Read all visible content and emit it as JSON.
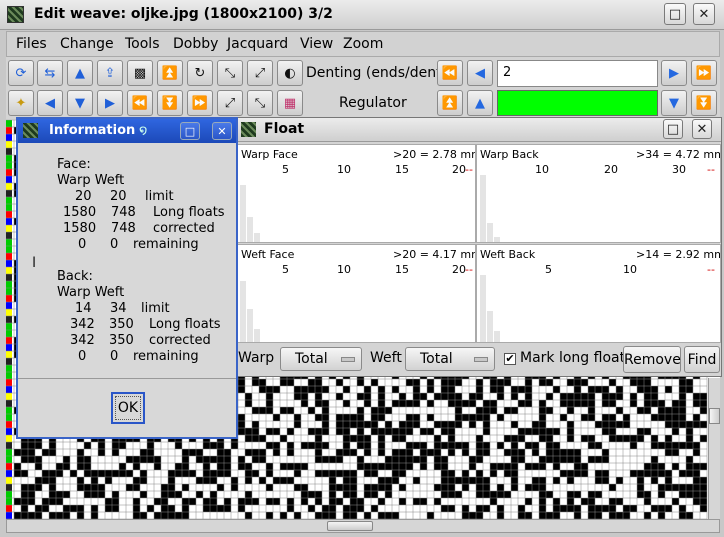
{
  "main_window": {
    "title": "Edit weave: oljke.jpg (1800x2100) 3/2",
    "buttons": {
      "maximize": "□",
      "close": "✕"
    }
  },
  "menubar": {
    "items": [
      "Files",
      "Change",
      "Tools",
      "Dobby",
      "Jacquard",
      "View",
      "Zoom"
    ]
  },
  "toolbar": {
    "denting_label": "Denting (ends/dent)",
    "denting_value": "2",
    "regulator_label": "Regulator",
    "regulator_color": "#00ff00"
  },
  "float_window": {
    "title": "Float",
    "panels": {
      "warp_face": {
        "label": "Warp  Face",
        "stat": ">20 = 2.78 mm: 0",
        "ticks": [
          "5",
          "10",
          "15",
          "20"
        ],
        "marker": "--"
      },
      "warp_back": {
        "label": "Warp  Back",
        "stat": ">34 = 4.72 mm: 0",
        "ticks": [
          "10",
          "20",
          "30"
        ],
        "marker": "--"
      },
      "weft_face": {
        "label": "Weft  Face",
        "stat": ">20 = 4.17 mm: 0",
        "ticks": [
          "5",
          "10",
          "15",
          "20"
        ],
        "marker": "--"
      },
      "weft_back": {
        "label": "Weft  Back",
        "stat": ">14 = 2.92 mm: 0",
        "ticks": [
          "5",
          "10"
        ],
        "marker": "--"
      }
    },
    "controls": {
      "warp_label": "Warp",
      "warp_select": "Total",
      "weft_label": "Weft",
      "weft_select": "Total",
      "mark_long_floats_label": "Mark long floats",
      "mark_long_floats_checked": true,
      "remove_label": "Remove",
      "find_label": "Find"
    }
  },
  "info_dialog": {
    "title": "Information",
    "face_heading": "Face:",
    "face_cols": "Warp Weft",
    "face_rows": [
      {
        "warp": "20",
        "weft": "20",
        "label": "limit"
      },
      {
        "warp": "1580",
        "weft": "748",
        "label": "Long floats"
      },
      {
        "warp": "1580",
        "weft": "748",
        "label": "corrected"
      },
      {
        "warp": "0",
        "weft": "0",
        "label": "remaining"
      }
    ],
    "back_heading": "Back:",
    "back_cols": "Warp Weft",
    "back_rows": [
      {
        "warp": "14",
        "weft": "34",
        "label": "limit"
      },
      {
        "warp": "342",
        "weft": "350",
        "label": "Long floats"
      },
      {
        "warp": "342",
        "weft": "350",
        "label": "corrected"
      },
      {
        "warp": "0",
        "weft": "0",
        "label": "remaining"
      }
    ],
    "ok_label": "OK"
  }
}
